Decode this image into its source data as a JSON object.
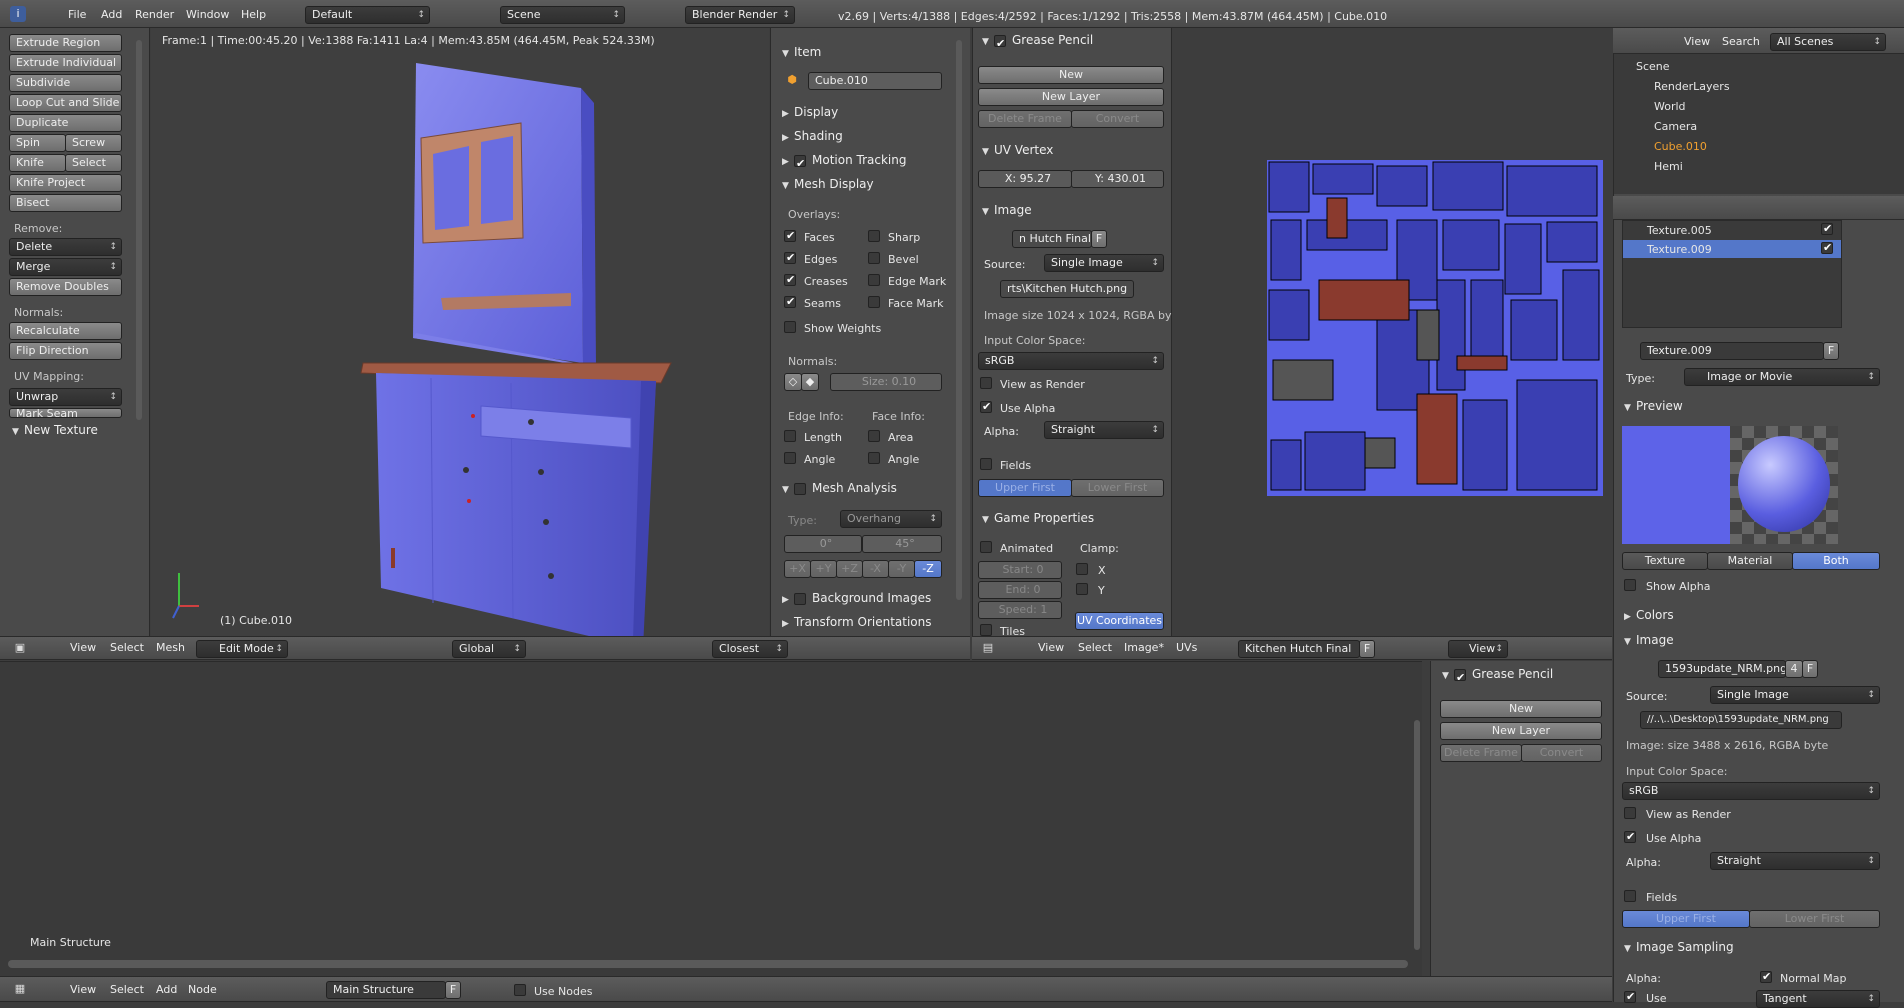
{
  "top_bar": {
    "menus": [
      "File",
      "Add",
      "Render",
      "Window",
      "Help"
    ],
    "layout": "Default",
    "scene": "Scene",
    "engine": "Blender Render",
    "stats": "v2.69 | Verts:4/1388 | Edges:4/2592 | Faces:1/1292 | Tris:2558 | Mem:43.87M (464.45M) | Cube.010"
  },
  "toolshelf": {
    "buttons": [
      "Extrude Region",
      "Extrude Individual",
      "Subdivide",
      "Loop Cut and Slide",
      "Duplicate"
    ],
    "spin": "Spin",
    "screw": "Screw",
    "knife": "Knife",
    "select": "Select",
    "knife_project": "Knife Project",
    "bisect": "Bisect",
    "remove_label": "Remove:",
    "delete": "Delete",
    "merge": "Merge",
    "remove_doubles": "Remove Doubles",
    "normals_label": "Normals:",
    "recalculate": "Recalculate",
    "flip_direction": "Flip Direction",
    "uv_mapping_label": "UV Mapping:",
    "unwrap": "Unwrap",
    "mark_seam": "Mark Seam",
    "new_texture": "New Texture"
  },
  "viewport": {
    "info": "Frame:1 | Time:00:45.20 | Ve:1388 Fa:1411 La:4 | Mem:43.85M (464.45M, Peak 524.33M)",
    "object_label": "(1) Cube.010",
    "header": {
      "menus": [
        "View",
        "Select",
        "Mesh"
      ],
      "mode": "Edit Mode",
      "orientation": "Global",
      "snap": "Closest"
    }
  },
  "properties_n": {
    "item": "Item",
    "object_name": "Cube.010",
    "display": "Display",
    "shading": "Shading",
    "motion_tracking": "Motion Tracking",
    "mesh_display": "Mesh Display",
    "overlays": "Overlays:",
    "faces": "Faces",
    "sharp": "Sharp",
    "edges": "Edges",
    "bevel": "Bevel",
    "creases": "Creases",
    "edge_mark": "Edge Mark",
    "seams": "Seams",
    "face_mark": "Face Mark",
    "show_weights": "Show Weights",
    "normals": "Normals:",
    "size": "Size: 0.10",
    "edge_info": "Edge Info:",
    "face_info": "Face Info:",
    "length": "Length",
    "area": "Area",
    "angle1": "Angle",
    "angle2": "Angle",
    "mesh_analysis": "Mesh Analysis",
    "type_label": "Type:",
    "type_value": "Overhang",
    "deg0": "0°",
    "deg45": "45°",
    "axes": [
      "+X",
      "+Y",
      "+Z",
      "-X",
      "-Y",
      "-Z"
    ],
    "background_images": "Background Images",
    "transform_orientations": "Transform Orientations"
  },
  "uv_panel": {
    "grease_pencil": "Grease Pencil",
    "new": "New",
    "new_layer": "New Layer",
    "delete_frame": "Delete Frame",
    "convert": "Convert",
    "uv_vertex": "UV Vertex",
    "x": "X: 95.27",
    "y": "Y: 430.01",
    "image": "Image",
    "image_name": "n Hutch Final",
    "f": "F",
    "source_label": "Source:",
    "source": "Single Image",
    "path": "rts\\Kitchen Hutch.png",
    "image_size": "Image size 1024 x 1024, RGBA by",
    "input_color_space": "Input Color Space:",
    "color_space": "sRGB",
    "view_as_render": "View as Render",
    "use_alpha": "Use Alpha",
    "alpha_label": "Alpha:",
    "alpha": "Straight",
    "fields": "Fields",
    "upper_first": "Upper First",
    "lower_first": "Lower First",
    "game_properties": "Game Properties",
    "animated": "Animated",
    "clamp": "Clamp:",
    "start": "Start: 0",
    "end": "End: 0",
    "speed": "Speed: 1",
    "cx": "X",
    "cy": "Y",
    "tiles": "Tiles",
    "uv_coordinates": "UV Coordinates"
  },
  "uv_header": {
    "menus": [
      "View",
      "Select",
      "Image*",
      "UVs"
    ],
    "image": "Kitchen Hutch Final",
    "f": "F",
    "view": "View"
  },
  "outliner": {
    "menus": [
      "View",
      "Search"
    ],
    "scope": "All Scenes",
    "items": [
      {
        "label": "Scene",
        "indent": 0
      },
      {
        "label": "RenderLayers",
        "indent": 1
      },
      {
        "label": "World",
        "indent": 1
      },
      {
        "label": "Camera",
        "indent": 1
      },
      {
        "label": "Cube.010",
        "indent": 1
      },
      {
        "label": "Hemi",
        "indent": 1
      }
    ]
  },
  "texture_props": {
    "slots": [
      "Texture.005",
      "Texture.009"
    ],
    "texture_name": "Texture.009",
    "f": "F",
    "type_label": "Type:",
    "type": "Image or Movie",
    "preview": "Preview",
    "tabs": [
      "Texture",
      "Material",
      "Both"
    ],
    "show_alpha": "Show Alpha",
    "colors": "Colors",
    "image": "Image",
    "image_name": "1593update_NRM.png",
    "users": "4",
    "source_label": "Source:",
    "source": "Single Image",
    "path": "//..\\..\\Desktop\\1593update_NRM.png",
    "image_size": "Image: size 3488 x 2616, RGBA byte",
    "input_color_space": "Input Color Space:",
    "color_space": "sRGB",
    "view_as_render": "View as Render",
    "use_alpha": "Use Alpha",
    "alpha_label": "Alpha:",
    "alpha": "Straight",
    "fields": "Fields",
    "upper_first": "Upper First",
    "lower_first": "Lower First",
    "image_sampling": "Image Sampling",
    "normal_map": "Normal Map",
    "use": "Use",
    "tangent": "Tangent"
  },
  "node_editor": {
    "label": "Main Structure",
    "header": {
      "menus": [
        "View",
        "Select",
        "Add",
        "Node"
      ],
      "tree": "Main Structure",
      "f": "F",
      "use_nodes": "Use Nodes"
    },
    "side": {
      "grease_pencil": "Grease Pencil",
      "new": "New",
      "new_layer": "New Layer",
      "delete_frame": "Delete Frame",
      "convert": "Convert"
    }
  }
}
